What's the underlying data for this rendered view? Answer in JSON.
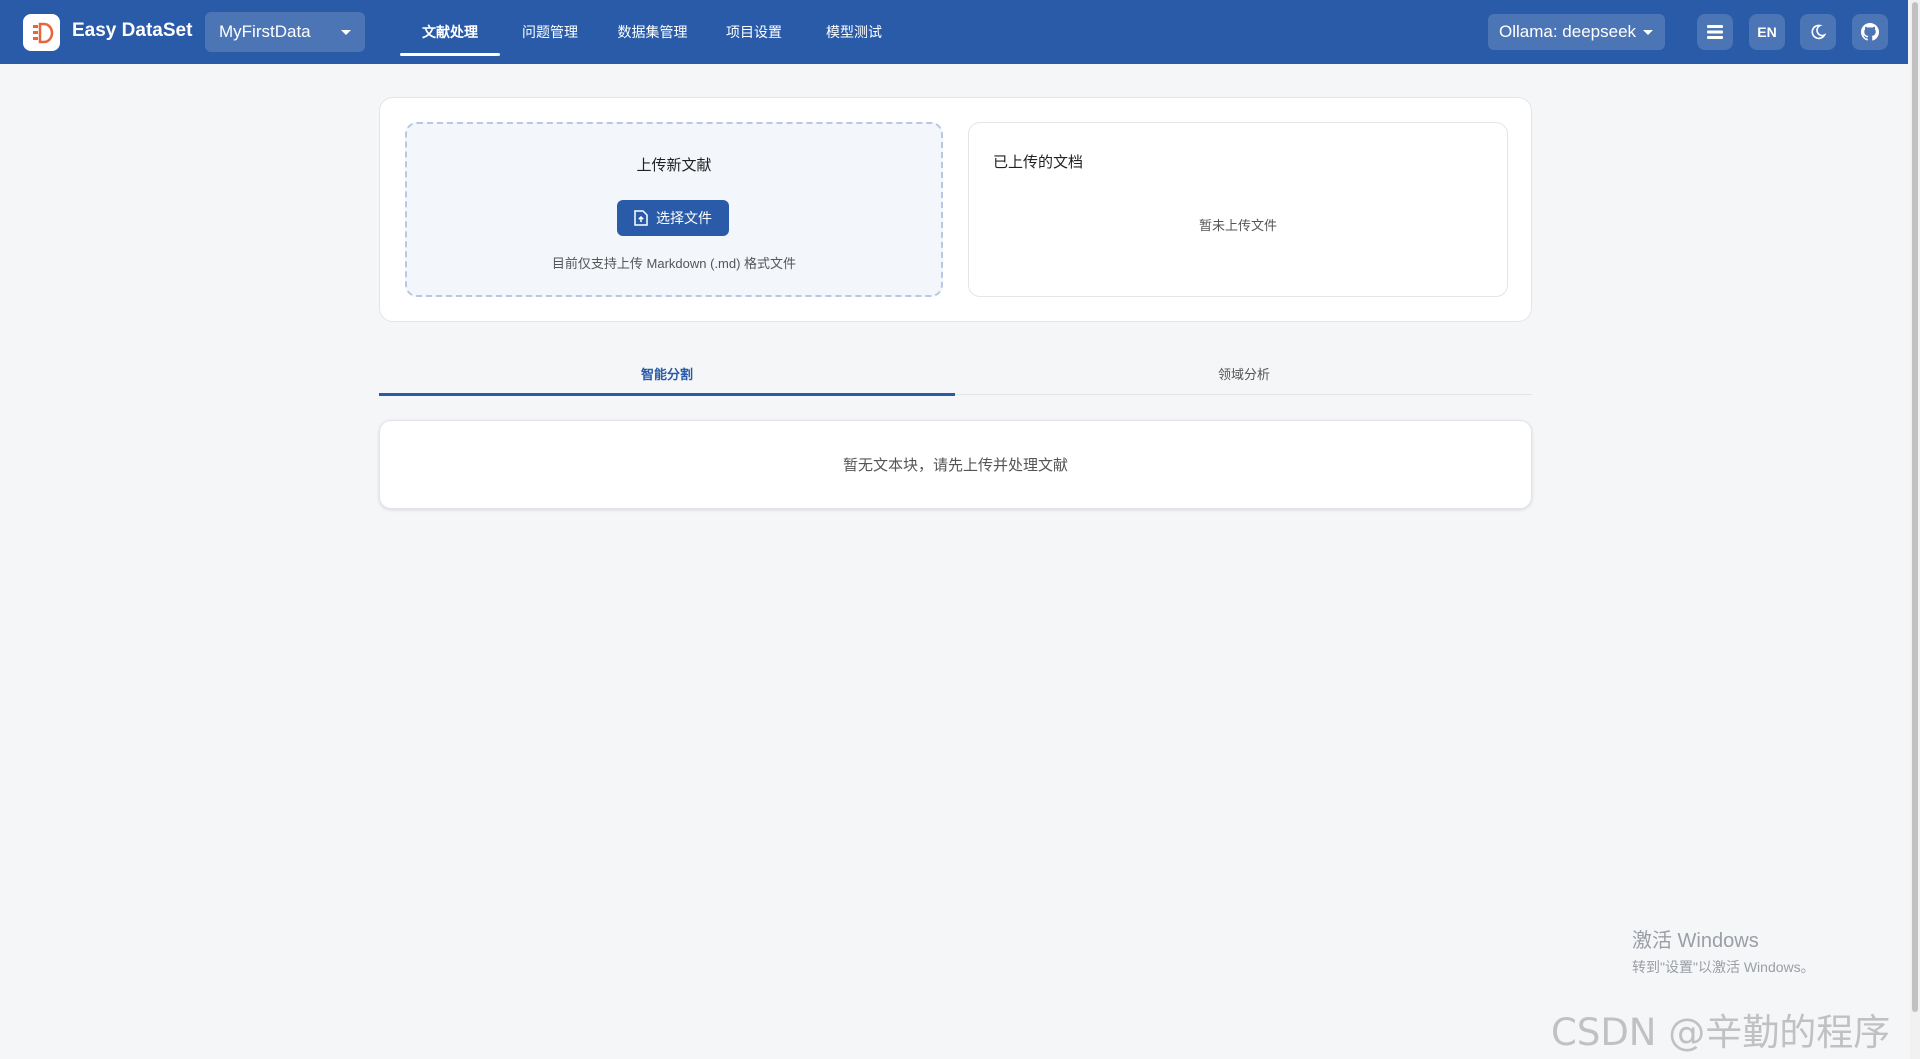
{
  "header": {
    "app_title": "Easy DataSet",
    "project": "MyFirstData",
    "nav": [
      {
        "label": "文献处理",
        "active": true
      },
      {
        "label": "问题管理",
        "active": false
      },
      {
        "label": "数据集管理",
        "active": false
      },
      {
        "label": "项目设置",
        "active": false
      },
      {
        "label": "模型测试",
        "active": false
      }
    ],
    "model": "Ollama: deepseek",
    "language": "EN",
    "icons": [
      "list-icon",
      "moon-icon",
      "github-icon"
    ]
  },
  "upload": {
    "title": "上传新文献",
    "button_label": "选择文件",
    "hint": "目前仅支持上传 Markdown (.md) 格式文件",
    "uploaded_title": "已上传的文档",
    "uploaded_empty": "暂未上传文件"
  },
  "tabs": [
    {
      "label": "智能分割",
      "active": true
    },
    {
      "label": "领域分析",
      "active": false
    }
  ],
  "chunks": {
    "empty_message": "暂无文本块，请先上传并处理文献"
  },
  "watermarks": {
    "windows_line1": "激活 Windows",
    "windows_line2": "转到\"设置\"以激活 Windows。",
    "csdn": "CSDN @辛勤的程序猿"
  },
  "colors": {
    "primary": "#2a5ba8",
    "background": "#f5f6f8"
  }
}
